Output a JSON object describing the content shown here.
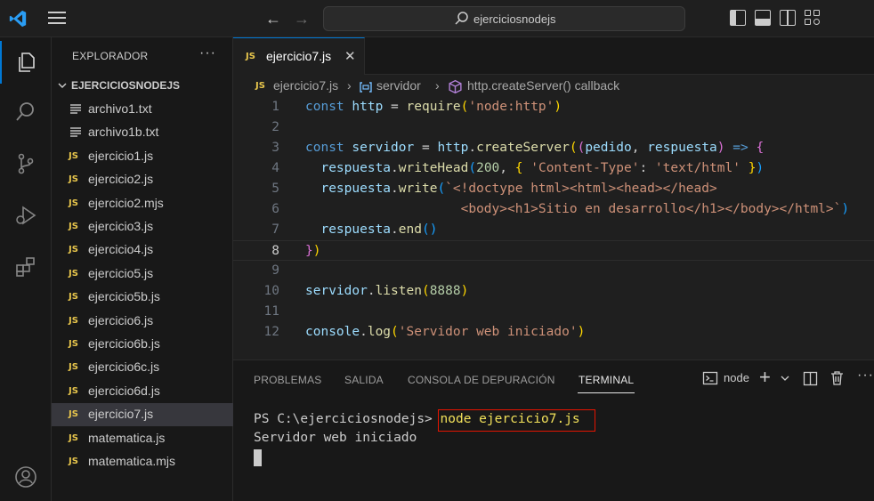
{
  "titlebar": {
    "search_text": "ejerciciosnodejs"
  },
  "sidebar": {
    "title": "EXPLORADOR",
    "more": "···",
    "folder_name": "EJERCICIOSNODEJS",
    "files": [
      {
        "name": "archivo1.txt",
        "type": "txt"
      },
      {
        "name": "archivo1b.txt",
        "type": "txt"
      },
      {
        "name": "ejercicio1.js",
        "type": "js"
      },
      {
        "name": "ejercicio2.js",
        "type": "js"
      },
      {
        "name": "ejercicio2.mjs",
        "type": "js"
      },
      {
        "name": "ejercicio3.js",
        "type": "js"
      },
      {
        "name": "ejercicio4.js",
        "type": "js"
      },
      {
        "name": "ejercicio5.js",
        "type": "js"
      },
      {
        "name": "ejercicio5b.js",
        "type": "js"
      },
      {
        "name": "ejercicio6.js",
        "type": "js"
      },
      {
        "name": "ejercicio6b.js",
        "type": "js"
      },
      {
        "name": "ejercicio6c.js",
        "type": "js"
      },
      {
        "name": "ejercicio6d.js",
        "type": "js"
      },
      {
        "name": "ejercicio7.js",
        "type": "js",
        "active": true
      },
      {
        "name": "matematica.js",
        "type": "js"
      },
      {
        "name": "matematica.mjs",
        "type": "js"
      }
    ],
    "js_badge": "JS"
  },
  "editor": {
    "tab_label": "ejercicio7.js",
    "tab_close": "✕",
    "breadcrumb": {
      "file": "ejercicio7.js",
      "sep": "›",
      "symbol1": "servidor",
      "symbol2": "http.createServer() callback"
    },
    "line_numbers": [
      "1",
      "2",
      "3",
      "4",
      "5",
      "6",
      "7",
      "8",
      "9",
      "10",
      "11",
      "12"
    ],
    "current_line": 8
  },
  "panel": {
    "tabs": [
      "PROBLEMAS",
      "SALIDA",
      "CONSOLA DE DEPURACIÓN",
      "TERMINAL"
    ],
    "active_tab": "TERMINAL",
    "terminal_name": "node",
    "prompt": "PS C:\\ejerciciosnodejs>",
    "command": "node ejercicio7.js",
    "output": "Servidor web iniciado"
  },
  "colors": {
    "accent": "#0078d4",
    "js_badge": "#e8c64c",
    "highlight_box": "#e51400"
  }
}
